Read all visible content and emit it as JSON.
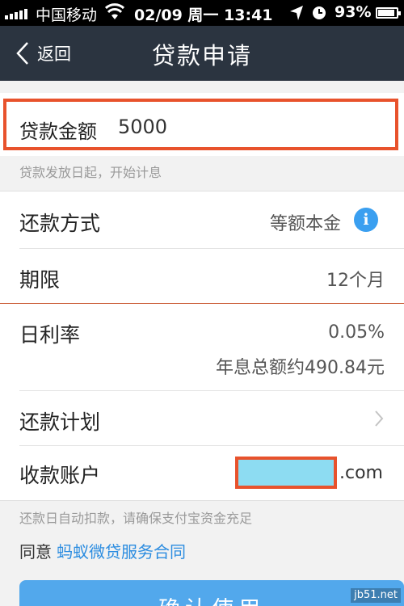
{
  "status_bar": {
    "carrier": "中国移动",
    "datetime": "02/09 周一 13:41",
    "battery": "93%",
    "battery_level": 0.93
  },
  "nav": {
    "back_label": "返回",
    "title": "贷款申请"
  },
  "amount": {
    "label": "贷款金额",
    "value": "5000",
    "hint": "贷款发放日起，开始计息"
  },
  "rows": {
    "repay_method": {
      "label": "还款方式",
      "value": "等额本金"
    },
    "term": {
      "label": "期限",
      "value": "12个月"
    },
    "daily_rate": {
      "label": "日利率",
      "value": "0.05%",
      "sub_value": "年息总额约490.84元"
    },
    "repay_plan": {
      "label": "还款计划"
    },
    "account": {
      "label": "收款账户",
      "suffix": ".com"
    }
  },
  "auto_deduct_hint": "还款日自动扣款，请确保支付宝资金充足",
  "agreement": {
    "prefix": "同意",
    "link": "蚂蚁微贷服务合同"
  },
  "confirm_button": "确认使用",
  "watermark": "jb51.net",
  "colors": {
    "nav_bg": "#2b3440",
    "highlight_border": "#e8522c",
    "info_blue": "#3a9ff0",
    "link_blue": "#2b8ce0",
    "button_blue": "#52a8ec"
  }
}
